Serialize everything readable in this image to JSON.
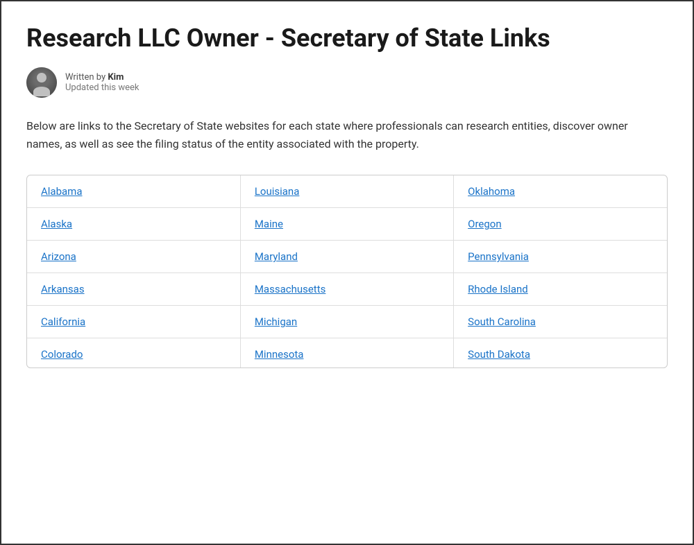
{
  "page": {
    "title": "Research LLC Owner - Secretary of State Links",
    "author": {
      "written_by_label": "Written by",
      "author_name": "Kim",
      "updated_label": "Updated this week"
    },
    "description": "Below are links to the Secretary of State websites for each state where professionals can research entities, discover owner names, as well as see the filing status of the entity associated with the property.",
    "table": {
      "rows": [
        {
          "col1": "Alabama",
          "col2": "Louisiana",
          "col3": "Oklahoma"
        },
        {
          "col1": "Alaska",
          "col2": "Maine",
          "col3": "Oregon"
        },
        {
          "col1": "Arizona",
          "col2": "Maryland",
          "col3": "Pennsylvania"
        },
        {
          "col1": "Arkansas",
          "col2": "Massachusetts",
          "col3": "Rhode Island"
        },
        {
          "col1": "California",
          "col2": "Michigan",
          "col3": "South Carolina"
        },
        {
          "col1": "Colorado",
          "col2": "Minnesota",
          "col3": "South Dakota"
        }
      ]
    }
  }
}
